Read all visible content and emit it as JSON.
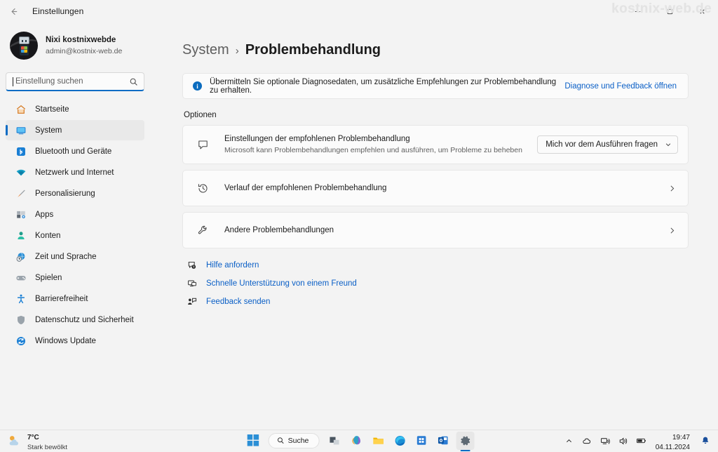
{
  "window": {
    "title": "Einstellungen",
    "back_label": "Zurück",
    "minimize_label": "Minimieren",
    "maximize_label": "Maximieren",
    "close_label": "Schließen",
    "watermark": "kostnix-web.de"
  },
  "account": {
    "name": "Nixi kostnixwebde",
    "email": "admin@kostnix-web.de"
  },
  "search": {
    "placeholder": "Einstellung suchen",
    "value": "",
    "icon": "search-icon"
  },
  "sidebar": {
    "items": [
      {
        "label": "Startseite",
        "icon": "home-icon",
        "selected": false
      },
      {
        "label": "System",
        "icon": "monitor-icon",
        "selected": true
      },
      {
        "label": "Bluetooth und Geräte",
        "icon": "bluetooth-icon",
        "selected": false
      },
      {
        "label": "Netzwerk und Internet",
        "icon": "wifi-icon",
        "selected": false
      },
      {
        "label": "Personalisierung",
        "icon": "brush-icon",
        "selected": false
      },
      {
        "label": "Apps",
        "icon": "apps-icon",
        "selected": false
      },
      {
        "label": "Konten",
        "icon": "person-icon",
        "selected": false
      },
      {
        "label": "Zeit und Sprache",
        "icon": "clock-globe-icon",
        "selected": false
      },
      {
        "label": "Spielen",
        "icon": "gamepad-icon",
        "selected": false
      },
      {
        "label": "Barrierefreiheit",
        "icon": "accessibility-icon",
        "selected": false
      },
      {
        "label": "Datenschutz und Sicherheit",
        "icon": "shield-icon",
        "selected": false
      },
      {
        "label": "Windows Update",
        "icon": "update-icon",
        "selected": false
      }
    ]
  },
  "main": {
    "breadcrumb_parent": "System",
    "breadcrumb_separator": "›",
    "breadcrumb_current": "Problembehandlung",
    "banner": {
      "icon": "info-icon",
      "text": "Übermitteln Sie optionale Diagnosedaten, um zusätzliche Empfehlungen zur Problembehandlung zu erhalten.",
      "link": "Diagnose und Feedback öffnen"
    },
    "section_label": "Optionen",
    "cards": [
      {
        "icon": "speech-bubble-icon",
        "title": "Einstellungen der empfohlenen Problembehandlung",
        "subtitle": "Microsoft kann Problembehandlungen empfehlen und ausführen, um Probleme zu beheben",
        "control": "dropdown",
        "dropdown_value": "Mich vor dem Ausführen fragen"
      },
      {
        "icon": "history-icon",
        "title": "Verlauf der empfohlenen Problembehandlung",
        "subtitle": "",
        "control": "chevron"
      },
      {
        "icon": "wrench-icon",
        "title": "Andere Problembehandlungen",
        "subtitle": "",
        "control": "chevron"
      }
    ],
    "links": [
      {
        "label": "Hilfe anfordern",
        "icon": "help-icon"
      },
      {
        "label": "Schnelle Unterstützung von einem Freund",
        "icon": "quick-assist-icon"
      },
      {
        "label": "Feedback senden",
        "icon": "feedback-icon"
      }
    ]
  },
  "taskbar": {
    "weather": {
      "temperature": "7°C",
      "condition": "Stark bewölkt",
      "icon": "partly-cloudy-icon"
    },
    "search_label": "Suche",
    "apps": [
      {
        "name": "start-button",
        "icon": "windows-logo-icon"
      },
      {
        "name": "task-view-button",
        "icon": "task-view-icon"
      },
      {
        "name": "copilot-button",
        "icon": "copilot-icon"
      },
      {
        "name": "file-explorer-button",
        "icon": "folder-icon"
      },
      {
        "name": "edge-button",
        "icon": "edge-icon"
      },
      {
        "name": "microsoft-store-button",
        "icon": "store-icon"
      },
      {
        "name": "outlook-button",
        "icon": "outlook-icon"
      },
      {
        "name": "settings-button",
        "icon": "gear-icon"
      }
    ],
    "tray": {
      "chevron": "show-hidden-icons",
      "onedrive": "cloud-icon",
      "network": "network-icon",
      "volume": "volume-icon",
      "battery": "battery-icon",
      "notification": "bell-icon"
    },
    "clock": {
      "time": "19:47",
      "date": "04.11.2024"
    }
  },
  "colors": {
    "accent": "#0d6cc4",
    "link": "#0a5fc6",
    "card_bg": "#fbfbfb",
    "page_bg": "#f3f3f3"
  }
}
